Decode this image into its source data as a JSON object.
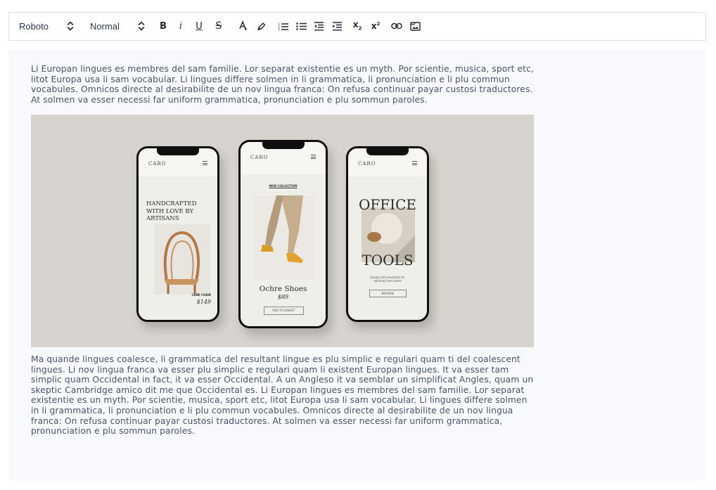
{
  "toolbar": {
    "font_family": "Roboto",
    "paragraph_style": "Normal",
    "buttons": {
      "bold": "B",
      "italic": "i",
      "underline": "U",
      "strike": "S",
      "subscript": "x",
      "subscript_mark": "2",
      "superscript": "x",
      "superscript_mark": "2"
    },
    "icons": [
      "chevron-updown-icon",
      "bold-icon",
      "italic-icon",
      "underline-icon",
      "strikethrough-icon",
      "text-color-icon",
      "highlight-icon",
      "ordered-list-icon",
      "bullet-list-icon",
      "outdent-icon",
      "indent-icon",
      "subscript-icon",
      "superscript-icon",
      "link-icon",
      "image-icon"
    ]
  },
  "editor": {
    "paragraph_1": "Li Europan lingues es membres del sam familie. Lor separat existentie es un myth. Por scientie, musica, sport etc, litot Europa usa li sam vocabular. Li lingues differe solmen in li grammatica, li pronunciation e li plu commun vocabules. Omnicos directe al desirabilite de un nov lingua franca: On refusa continuar payar custosi traductores. At solmen va esser necessi far uniform grammatica, pronunciation e plu sommun paroles.",
    "paragraph_2": "Ma quande lingues coalesce, li grammatica del resultant lingue es plu simplic e regulari quam ti del coalescent lingues. Li nov lingua franca va esser plu simplic e regulari quam li existent Europan lingues. It va esser tam simplic quam Occidental in fact, it va esser Occidental. A un Angleso it va semblar un simplificat Angles, quam un skeptic Cambridge amico dit me que Occidental es. Li Europan lingues es membres del sam familie. Lor separat existentie es un myth. Por scientie, musica, sport etc, litot Europa usa li sam vocabular. Li lingues differe solmen in li grammatica, li pronunciation e li plu commun vocabules. Omnicos directe al desirabilite de un nov lingua franca: On refusa continuar payar custosi traductores. At solmen va esser necessi far uniform grammatica, pronunciation e plu sommun paroles.",
    "image": {
      "phone_1": {
        "brand": "CARO",
        "headline_1": "HANDCRAFTED",
        "headline_2": "WITH LOVE BY",
        "headline_3": "ARTISANS",
        "product": "CANE CHAIR",
        "price": "$149"
      },
      "phone_2": {
        "brand": "CARO",
        "section": "NEW COLLECTION",
        "product": "Ochre Shoes",
        "price": "$89",
        "cta": "ADD TO BASKET"
      },
      "phone_3": {
        "brand": "CARO",
        "title_1": "OFFICE",
        "title_2": "TOOLS",
        "subtitle_1": "Design led essentials for",
        "subtitle_2": "working from home",
        "cta": "BROWSE"
      }
    }
  },
  "colors": {
    "editor_bg": "#f8f9fd",
    "toolbar_border": "#dde1e7",
    "text": "#475569",
    "image_bg": "#d7d3ce"
  }
}
